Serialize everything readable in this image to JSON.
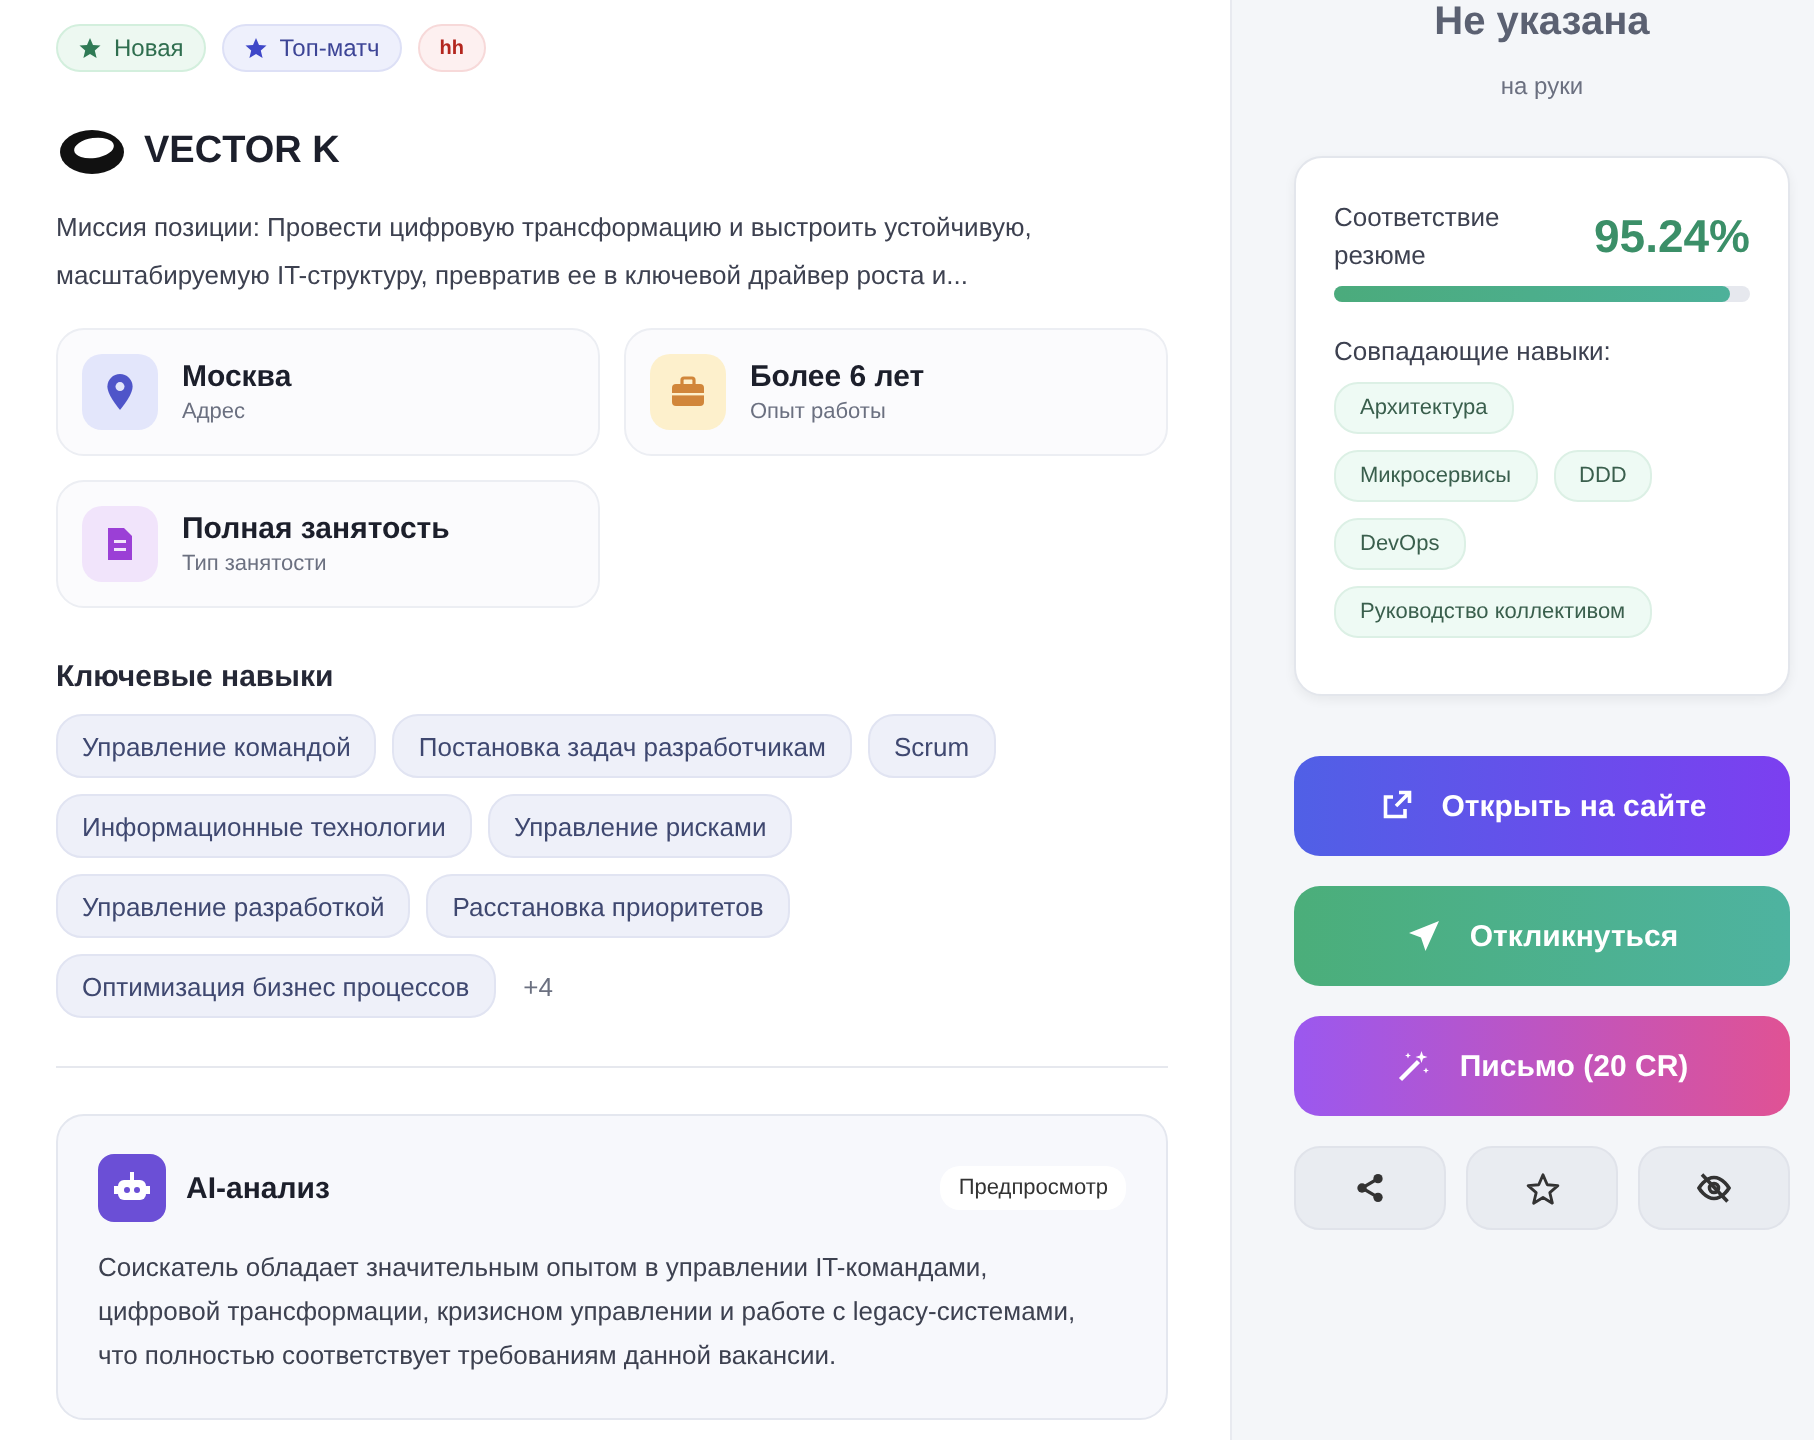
{
  "badges": [
    {
      "kind": "new",
      "label": "Новая"
    },
    {
      "kind": "top",
      "label": "Топ-матч"
    },
    {
      "kind": "source",
      "label": "hh"
    }
  ],
  "company": {
    "name": "VECTOR K"
  },
  "description": "Миссия позиции: Провести цифровую трансформацию и выстроить устойчивую, масштабируемую IT-структуру, превратив ее в ключевой драйвер роста и...",
  "info_cards": [
    {
      "kind": "location",
      "value": "Москва",
      "label": "Адрес"
    },
    {
      "kind": "experience",
      "value": "Более 6 лет",
      "label": "Опыт работы"
    },
    {
      "kind": "employment",
      "value": "Полная занятость",
      "label": "Тип занятости"
    }
  ],
  "key_skills": {
    "title": "Ключевые навыки",
    "items": [
      "Управление командой",
      "Постановка задач разработчикам",
      "Scrum",
      "Информационные технологии",
      "Управление рисками",
      "Управление разработкой",
      "Расстановка приоритетов",
      "Оптимизация бизнес процессов"
    ],
    "more": "+4"
  },
  "ai_analysis": {
    "title": "AI-анализ",
    "badge": "Предпросмотр",
    "text": "Соискатель обладает значительным опытом в управлении IT-командами, цифровой трансформации, кризисном управлении и работе с legacy-системами, что полностью соответствует требованиям данной вакансии."
  },
  "salary": {
    "value": "Не указана",
    "note": "на руки"
  },
  "match": {
    "label": "Соответствие резюме",
    "percent": "95.24%",
    "level": 0.9524,
    "skills_title": "Совпадающие навыки:",
    "skills": [
      "Архитектура",
      "Микросервисы",
      "DDD",
      "DevOps",
      "Руководство коллективом"
    ]
  },
  "actions": [
    {
      "kind": "open",
      "label": "Открыть на сайте"
    },
    {
      "kind": "apply",
      "label": "Откликнуться"
    },
    {
      "kind": "letter",
      "label": "Письмо (20 CR)"
    }
  ],
  "icon_actions": [
    {
      "kind": "share"
    },
    {
      "kind": "favorite"
    },
    {
      "kind": "hide"
    }
  ]
}
